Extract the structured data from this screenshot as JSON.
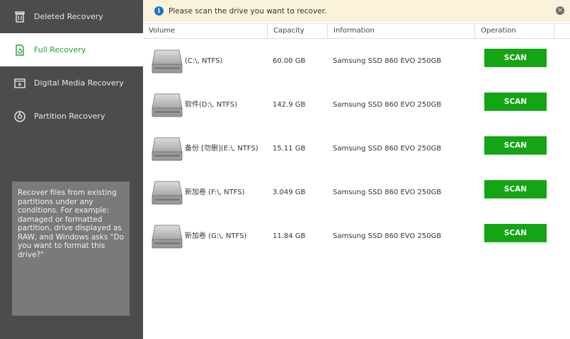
{
  "sidebar": {
    "items": [
      {
        "label": "Deleted Recovery",
        "icon": "trash-icon"
      },
      {
        "label": "Full Recovery",
        "icon": "refresh-icon"
      },
      {
        "label": "Digital Media Recovery",
        "icon": "media-icon"
      },
      {
        "label": "Partition Recovery",
        "icon": "partition-icon"
      }
    ],
    "active_index": 1,
    "help_text": "Recover files from existing partitions under any conditions. For example: damaged or formatted partition, drive displayed as RAW, and Windows asks \"Do you want to format this drive?\""
  },
  "notice": {
    "text": "Please scan the drive you want to recover.",
    "info_glyph": "i",
    "close_glyph": "×"
  },
  "table": {
    "headers": {
      "volume": "Volume",
      "capacity": "Capacity",
      "information": "Information",
      "operation": "Operation"
    },
    "rows": [
      {
        "volume": "(C:\\, NTFS)",
        "capacity": "60.00 GB",
        "information": "Samsung SSD 860 EVO 250GB",
        "button": "SCAN"
      },
      {
        "volume": "软件(D:\\, NTFS)",
        "capacity": "142.9 GB",
        "information": "Samsung SSD 860 EVO 250GB",
        "button": "SCAN"
      },
      {
        "volume": "备份 [勿删](E:\\, NTFS)",
        "capacity": "15.11 GB",
        "information": "Samsung SSD 860 EVO 250GB",
        "button": "SCAN"
      },
      {
        "volume": "新加卷 (F:\\, NTFS)",
        "capacity": "3.049 GB",
        "information": "Samsung SSD 860 EVO 250GB",
        "button": "SCAN"
      },
      {
        "volume": "新加卷 (G:\\, NTFS)",
        "capacity": "11.84 GB",
        "information": "Samsung SSD 860 EVO 250GB",
        "button": "SCAN"
      }
    ]
  },
  "colors": {
    "sidebar_bg": "#4c4c4c",
    "accent_green": "#14a514",
    "active_text": "#1aa52f",
    "notice_bg": "#fbf3d9",
    "info_blue": "#1f6fcf"
  }
}
